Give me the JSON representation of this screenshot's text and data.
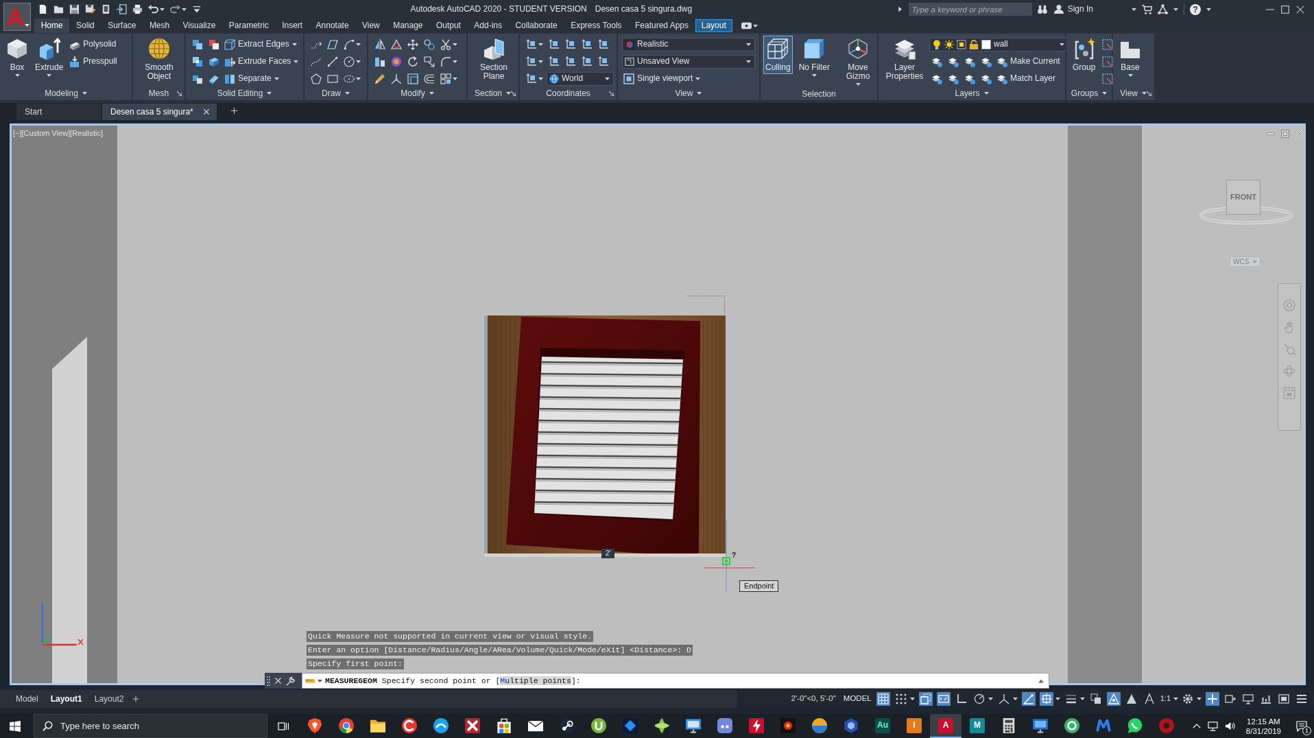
{
  "app_button": {
    "label": "A"
  },
  "title_bar": {
    "title": "Autodesk AutoCAD 2020 - STUDENT VERSION",
    "file": "Desen casa 5 singura.dwg",
    "search": {
      "placeholder": "Type a keyword or phrase"
    },
    "sign_in": "Sign In",
    "help": "?"
  },
  "ribbon_tabs": [
    {
      "label": "Home",
      "kind": "standard",
      "selected": true
    },
    {
      "label": "Solid",
      "kind": "standard",
      "selected": false
    },
    {
      "label": "Surface",
      "kind": "standard",
      "selected": false
    },
    {
      "label": "Mesh",
      "kind": "standard",
      "selected": false
    },
    {
      "label": "Visualize",
      "kind": "standard",
      "selected": false
    },
    {
      "label": "Parametric",
      "kind": "standard",
      "selected": false
    },
    {
      "label": "Insert",
      "kind": "standard",
      "selected": false
    },
    {
      "label": "Annotate",
      "kind": "standard",
      "selected": false
    },
    {
      "label": "View",
      "kind": "standard",
      "selected": false
    },
    {
      "label": "Manage",
      "kind": "standard",
      "selected": false
    },
    {
      "label": "Output",
      "kind": "standard",
      "selected": false
    },
    {
      "label": "Add-ins",
      "kind": "standard",
      "selected": false
    },
    {
      "label": "Collaborate",
      "kind": "standard",
      "selected": false
    },
    {
      "label": "Express Tools",
      "kind": "standard",
      "selected": false
    },
    {
      "label": "Featured Apps",
      "kind": "standard",
      "selected": false
    },
    {
      "label": "Layout",
      "kind": "contextual",
      "selected": false
    }
  ],
  "ribbon_panels": [
    {
      "title": "Modeling",
      "dropdown": true,
      "items": [
        {
          "kind": "large",
          "label": "Box",
          "dropdown": true
        },
        {
          "kind": "large",
          "label": "Extrude",
          "dropdown": true
        },
        {
          "kind": "small",
          "label": "Polysolid"
        },
        {
          "kind": "small",
          "label": "Presspull"
        }
      ]
    },
    {
      "title": "Mesh",
      "launcher": true,
      "items": [
        {
          "kind": "large",
          "label": "Smooth Object"
        }
      ]
    },
    {
      "title": "Solid Editing",
      "dropdown": true,
      "items": [
        {
          "kind": "small",
          "label": "Extract Edges",
          "dropdown": true
        },
        {
          "kind": "small",
          "label": "Extrude Faces",
          "dropdown": true
        },
        {
          "kind": "small",
          "label": "Separate",
          "dropdown": true
        }
      ]
    },
    {
      "title": "Draw",
      "dropdown": true
    },
    {
      "title": "Modify",
      "dropdown": true
    },
    {
      "title": "Section",
      "dropdown": true,
      "launcher": true,
      "items": [
        {
          "kind": "large",
          "label": "Section Plane"
        }
      ]
    },
    {
      "title": "Coordinates",
      "launcher": true,
      "items": [
        {
          "kind": "combo",
          "label": "World"
        }
      ]
    },
    {
      "title": "View",
      "dropdown": true,
      "items": [
        {
          "kind": "combo",
          "label": "Realistic"
        },
        {
          "kind": "combo",
          "label": "Unsaved View"
        },
        {
          "kind": "small",
          "label": "Single viewport",
          "dropdown": true
        }
      ]
    },
    {
      "title": "Selection",
      "items": [
        {
          "kind": "large",
          "label": "Culling",
          "on": true
        },
        {
          "kind": "large",
          "label": "No Filter",
          "dropdown": true,
          "on": false
        },
        {
          "kind": "large",
          "label": "Move Gizmo",
          "dropdown": true,
          "on": false
        }
      ]
    },
    {
      "title": "Layers",
      "dropdown": true,
      "items": [
        {
          "kind": "large",
          "label": "Layer Properties"
        },
        {
          "kind": "combo",
          "label": "wall"
        },
        {
          "kind": "small",
          "label": "Make Current"
        },
        {
          "kind": "small",
          "label": "Match Layer"
        }
      ]
    },
    {
      "title": "Groups",
      "dropdown": true,
      "items": [
        {
          "kind": "large",
          "label": "Group"
        }
      ]
    },
    {
      "title": "View",
      "dropdown": true,
      "launcher": true,
      "items": [
        {
          "kind": "large",
          "label": "Base",
          "dropdown": true
        }
      ]
    }
  ],
  "document_tabs": [
    {
      "label": "Start",
      "selected": false
    },
    {
      "label": "Desen casa 5 singura*",
      "selected": true
    }
  ],
  "viewport": {
    "controls": [
      "[−]",
      "[Custom View]",
      "[Realistic]"
    ],
    "viewcube": {
      "face": "FRONT",
      "coordinate_system": "WCS"
    },
    "dimension": "2'",
    "snap": {
      "hint": "?",
      "tooltip": "Endpoint"
    }
  },
  "command_history": [
    "Quick Measure not supported in current view or visual style.",
    "Enter an option [Distance/Radius/Angle/ARea/Volume/Quick/Mode/eXit] <Distance>: D",
    "Specify first point:"
  ],
  "command_line": {
    "prompt_start": "**MEASUREGEOM** Specify second point or [",
    "option": "Multiple points",
    "prompt_end": "]:"
  },
  "status_bar": {
    "layout_tabs": [
      {
        "label": "Model",
        "selected": false
      },
      {
        "label": "Layout1",
        "selected": true
      },
      {
        "label": "Layout2",
        "selected": false
      }
    ],
    "coordinates": "2'-0\"<0, 5'-0\"",
    "space": "MODEL",
    "toggles": [
      {
        "on": true
      },
      {
        "on": false
      },
      {
        "on": true
      },
      {
        "on": true
      },
      {
        "on": false
      },
      {
        "on": false
      },
      {
        "on": false
      },
      {
        "on": true
      },
      {
        "on": true
      },
      {
        "on": false
      },
      {
        "on": false
      },
      {
        "on": true
      },
      {
        "on": false
      },
      {
        "on": false
      }
    ],
    "annotation_scale": "1:1",
    "more_toggles": [
      {
        "on": false
      },
      {
        "on": true
      },
      {
        "on": false
      },
      {
        "on": false
      },
      {
        "on": false
      },
      {
        "on": false
      },
      {
        "on": false
      }
    ]
  },
  "taskbar": {
    "search": {
      "placeholder": "Type here to search"
    },
    "apps": [
      {
        "selected": false
      },
      {
        "selected": false
      },
      {
        "selected": false
      },
      {
        "selected": false
      },
      {
        "selected": false
      },
      {
        "selected": false
      },
      {
        "selected": false
      },
      {
        "selected": false
      },
      {
        "selected": false
      },
      {
        "selected": false
      },
      {
        "selected": false
      },
      {
        "selected": false
      },
      {
        "selected": false
      },
      {
        "selected": false
      },
      {
        "selected": false
      },
      {
        "selected": false
      },
      {
        "selected": false
      },
      {
        "selected": false
      },
      {
        "label": "Au",
        "selected": false
      },
      {
        "label": "I",
        "selected": false
      },
      {
        "label": "A",
        "selected": true
      },
      {
        "label": "M",
        "selected": false
      },
      {
        "selected": false
      },
      {
        "selected": false
      },
      {
        "selected": false
      },
      {
        "selected": false
      },
      {
        "selected": false
      },
      {
        "selected": false
      }
    ],
    "clock": {
      "time": "12:15 AM",
      "date": "8/31/2019"
    },
    "notifications": "1"
  }
}
